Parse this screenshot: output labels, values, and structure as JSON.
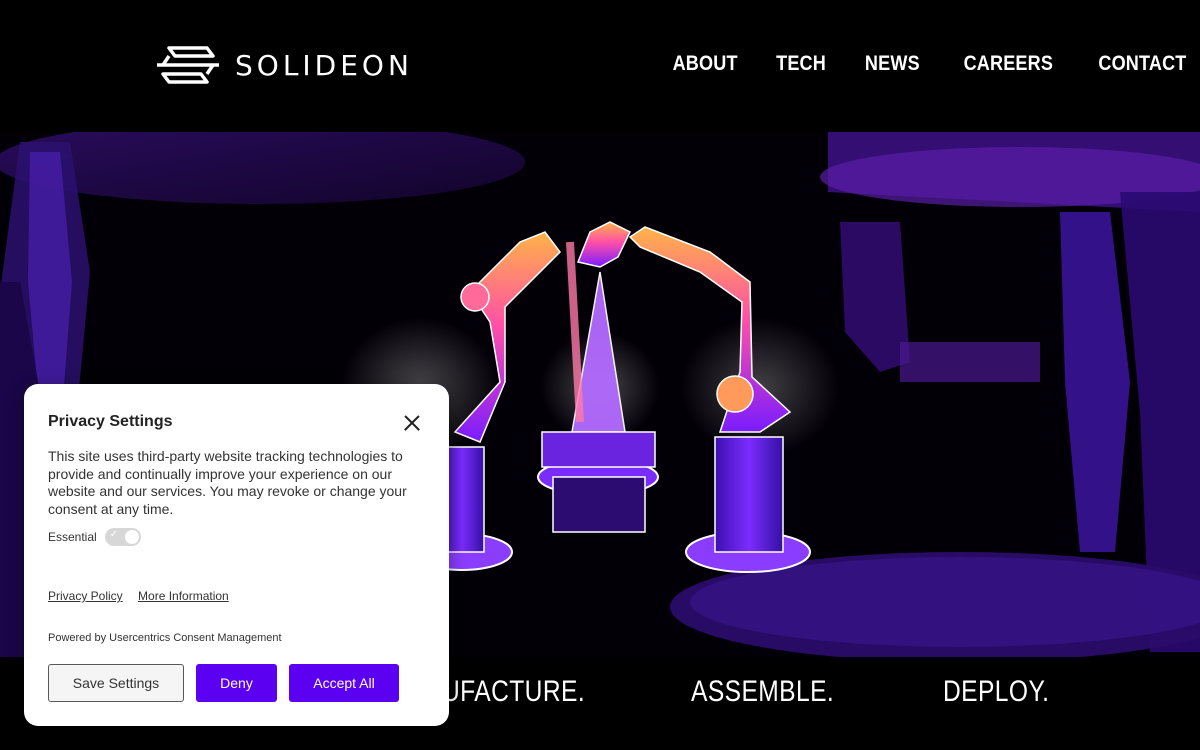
{
  "brand": {
    "name": "SOLIDEON"
  },
  "nav": {
    "items": [
      {
        "label": "ABOUT"
      },
      {
        "label": "TECH"
      },
      {
        "label": "NEWS"
      },
      {
        "label": "CAREERS"
      },
      {
        "label": "CONTACT"
      }
    ]
  },
  "taglines": [
    "UFACTURE.",
    "ASSEMBLE.",
    "DEPLOY."
  ],
  "consent": {
    "title": "Privacy Settings",
    "description": "This site uses third-party website tracking technologies to provide and continually improve your experience on our website and our services. You may revoke or change your consent at any time.",
    "essential_label": "Essential",
    "privacy_policy_link": "Privacy Policy",
    "more_info_link": "More Information",
    "powered_by": "Powered by Usercentrics Consent Management",
    "save_label": "Save Settings",
    "deny_label": "Deny",
    "accept_label": "Accept All",
    "accent_color": "#5c00f2"
  }
}
